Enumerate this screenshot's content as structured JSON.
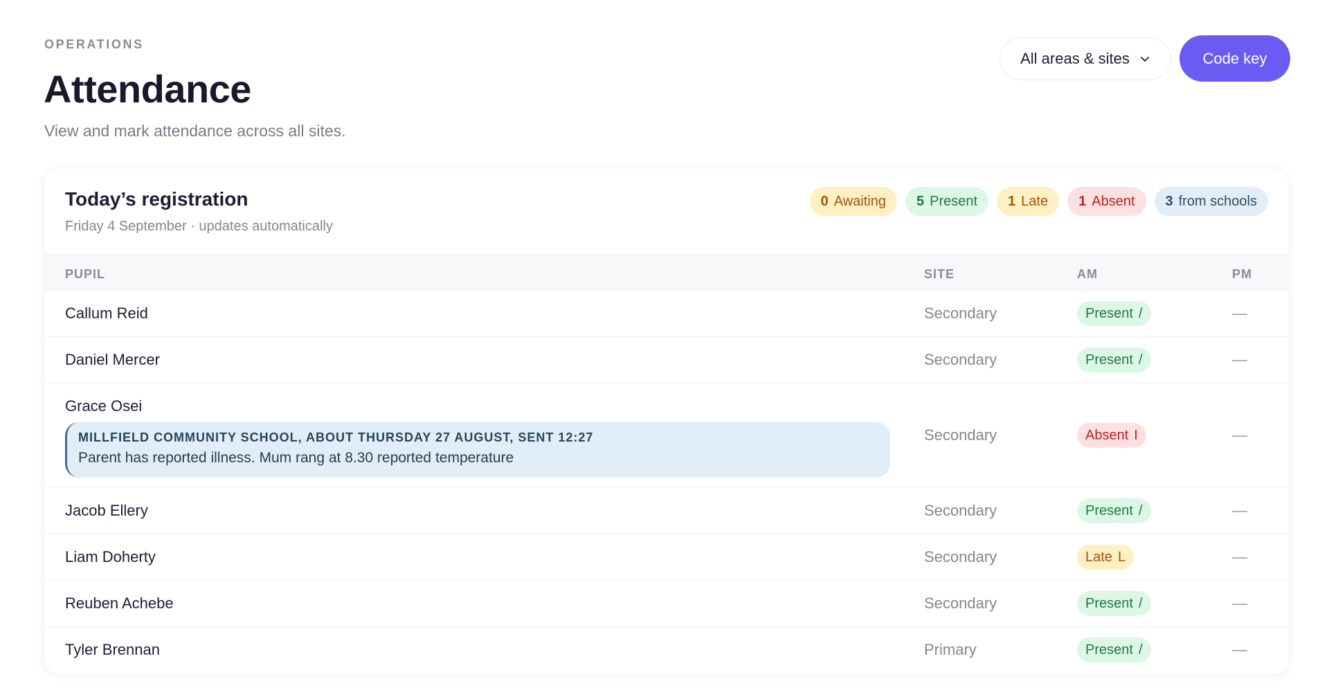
{
  "header": {
    "eyebrow": "OPERATIONS",
    "title": "Attendance",
    "subtitle": "View and mark attendance across all sites.",
    "filter_label": "All areas & sites",
    "code_key_label": "Code key"
  },
  "card": {
    "title": "Today’s registration",
    "subtitle": "Friday 4 September · updates automatically",
    "badges": [
      {
        "count": "0",
        "label": "Awaiting"
      },
      {
        "count": "5",
        "label": "Present"
      },
      {
        "count": "1",
        "label": "Late"
      },
      {
        "count": "1",
        "label": "Absent"
      },
      {
        "count": "3",
        "label": "from schools"
      }
    ]
  },
  "table": {
    "columns": [
      "PUPIL",
      "SITE",
      "AM",
      "PM"
    ],
    "rows": [
      {
        "pupil": "Callum Reid",
        "site": "Secondary",
        "am_label": "Present",
        "am_code": "/",
        "pm": "—"
      },
      {
        "pupil": "Daniel Mercer",
        "site": "Secondary",
        "am_label": "Present",
        "am_code": "/",
        "pm": "—"
      },
      {
        "pupil": "Grace Osei",
        "site": "Secondary",
        "am_label": "Absent",
        "am_code": "I",
        "pm": "—",
        "note_header": "MILLFIELD COMMUNITY SCHOOL, ABOUT THURSDAY 27 AUGUST, SENT 12:27",
        "note_body": "Parent has reported illness. Mum rang at 8.30 reported temperature"
      },
      {
        "pupil": "Jacob Ellery",
        "site": "Secondary",
        "am_label": "Present",
        "am_code": "/",
        "pm": "—"
      },
      {
        "pupil": "Liam Doherty",
        "site": "Secondary",
        "am_label": "Late",
        "am_code": "L",
        "pm": "—"
      },
      {
        "pupil": "Reuben Achebe",
        "site": "Secondary",
        "am_label": "Present",
        "am_code": "/",
        "pm": "—"
      },
      {
        "pupil": "Tyler Brennan",
        "site": "Primary",
        "am_label": "Present",
        "am_code": "/",
        "pm": "—"
      }
    ]
  },
  "colors": {
    "accent": "#6a5cf2",
    "present": "#1e7a44",
    "absent": "#b3242a",
    "late": "#a2540b",
    "note": "#e1eef7"
  },
  "icons": {
    "filter": "chevron-down-icon"
  }
}
